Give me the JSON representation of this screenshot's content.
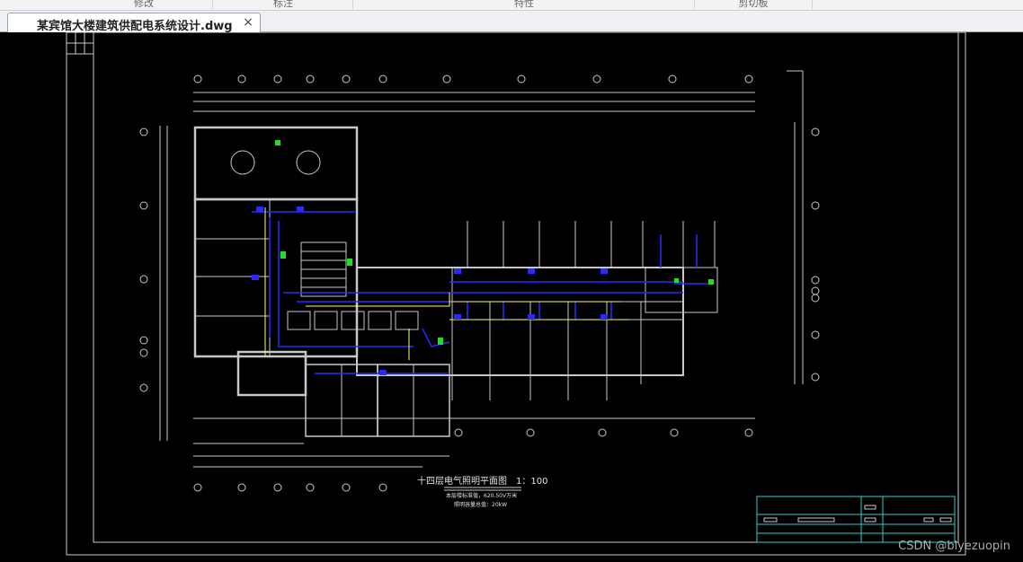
{
  "ribbon": {
    "groups": [
      "修改",
      "标注",
      "特性",
      "剪切板"
    ]
  },
  "tab": {
    "title": "某宾馆大楼建筑供配电系统设计.dwg",
    "close": "×"
  },
  "drawing": {
    "title": "十四层电气照明平面图　1：100",
    "note1": "本层楼标准值，620.50V万米",
    "note2": "照明容量总值：20kW"
  },
  "watermark": "CSDN @biyezuopin",
  "colors": {
    "background": "#000000",
    "linework": "#c8c8c8",
    "wiring": "#2a2aff",
    "lighting": "#ffff66",
    "fixtures": "#22dd22",
    "titleblock": "#33cccc"
  }
}
